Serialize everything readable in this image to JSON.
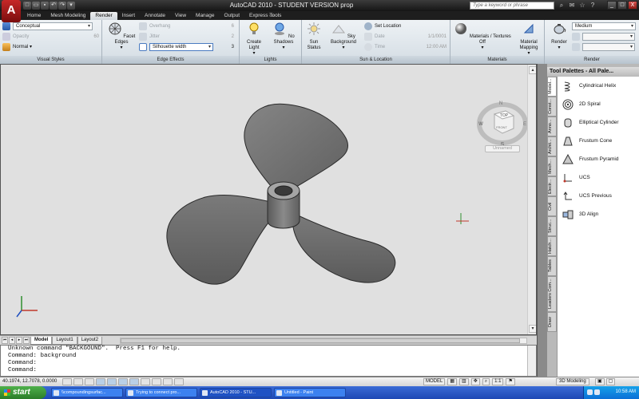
{
  "window": {
    "logo": "A",
    "title": "AutoCAD 2010 - STUDENT VERSION   prop",
    "search_placeholder": "Type a keyword or phrase",
    "controls": [
      "_",
      "□",
      "X"
    ]
  },
  "quick_access": [
    "new-icon",
    "open-icon",
    "save-icon",
    "undo-icon",
    "redo-icon",
    "plot-icon"
  ],
  "tabs": [
    "Home",
    "Mesh Modeling",
    "Render",
    "Insert",
    "Annotate",
    "View",
    "Manage",
    "Output",
    "Express Tools"
  ],
  "active_tab": "Render",
  "ribbon": {
    "visual_styles": {
      "title": "Visual Styles",
      "style_value": "Conceptual",
      "opacity_label": "Opacity",
      "opacity_value": "60",
      "face_style": "Normal"
    },
    "edge_effects": {
      "title": "Edge Effects",
      "facet_edges_label": "Facet Edges",
      "overhang_label": "Overhang",
      "overhang_value": "6",
      "jitter_label": "Jitter",
      "jitter_value": "2",
      "silhouette_label": "Silhouette width",
      "silhouette_value": "3"
    },
    "lights": {
      "title": "Lights",
      "create_light": "Create Light",
      "no_shadows": "No Shadows"
    },
    "sun_location": {
      "title": "Sun & Location",
      "sun_status": "Sun Status",
      "sky_background": "Sky Background",
      "set_location": "Set Location",
      "date_label": "Date",
      "date_value": "1/1/0001",
      "time_label": "Time",
      "time_value": "12:00 AM"
    },
    "materials": {
      "title": "Materials",
      "materials_textures": "Materials / Textures Off",
      "material_mapping": "Material Mapping"
    },
    "render": {
      "title": "Render",
      "render_label": "Render",
      "quality": "Medium"
    }
  },
  "viewport": {
    "label": "",
    "viewcube_top": "TOP",
    "viewcube_front": "FRONT",
    "compass": [
      "N",
      "W",
      "E",
      "S"
    ],
    "named_view": "Unnamed"
  },
  "layout_tabs": [
    "Model",
    "Layout1",
    "Layout2"
  ],
  "active_layout": "Model",
  "command_lines": [
    "Unknown command \"BACKGOUND\".  Press F1 for help.",
    "Command: background",
    "Command:",
    "Command:"
  ],
  "status": {
    "coords": "40.1974, 12.7078, 0.0000",
    "model": "MODEL",
    "scale": "1:1",
    "workspace": "3D Modeling"
  },
  "tool_palette": {
    "title": "Tool Palettes - All Pale...",
    "side_tabs": [
      "Model...",
      "Const...",
      "Anno...",
      "Archit...",
      "Mech...",
      "Electr...",
      "Civil",
      "Struc...",
      "Hatch...",
      "Tables",
      "Leaders Com...",
      "Draw"
    ],
    "items": [
      {
        "label": "Cylindrical Helix",
        "icon": "helix-icon"
      },
      {
        "label": "2D Spiral",
        "icon": "spiral-icon"
      },
      {
        "label": "Elliptical Cylinder",
        "icon": "cylinder-icon"
      },
      {
        "label": "Frustum Cone",
        "icon": "cone-icon"
      },
      {
        "label": "Frustum Pyramid",
        "icon": "pyramid-icon"
      },
      {
        "label": "UCS",
        "icon": "ucs-icon"
      },
      {
        "label": "UCS Previous",
        "icon": "ucs-previous-icon"
      },
      {
        "label": "3D Align",
        "icon": "align-icon"
      }
    ]
  },
  "taskbar": {
    "start": "start",
    "items": [
      "\\\\compoundingsurfac...",
      "Trying to connect pro...",
      "AutoCAD 2010 - STU...",
      "Untitled - Paint"
    ],
    "active_index": 2,
    "clock": "10:58 AM"
  },
  "colors": {
    "ribbon_bg": "#e3e9ee",
    "viewport_bg": "#e0e0e0",
    "model_fill": "#6f6f6f",
    "taskbar": "#245edb",
    "start": "#3a9a37"
  }
}
